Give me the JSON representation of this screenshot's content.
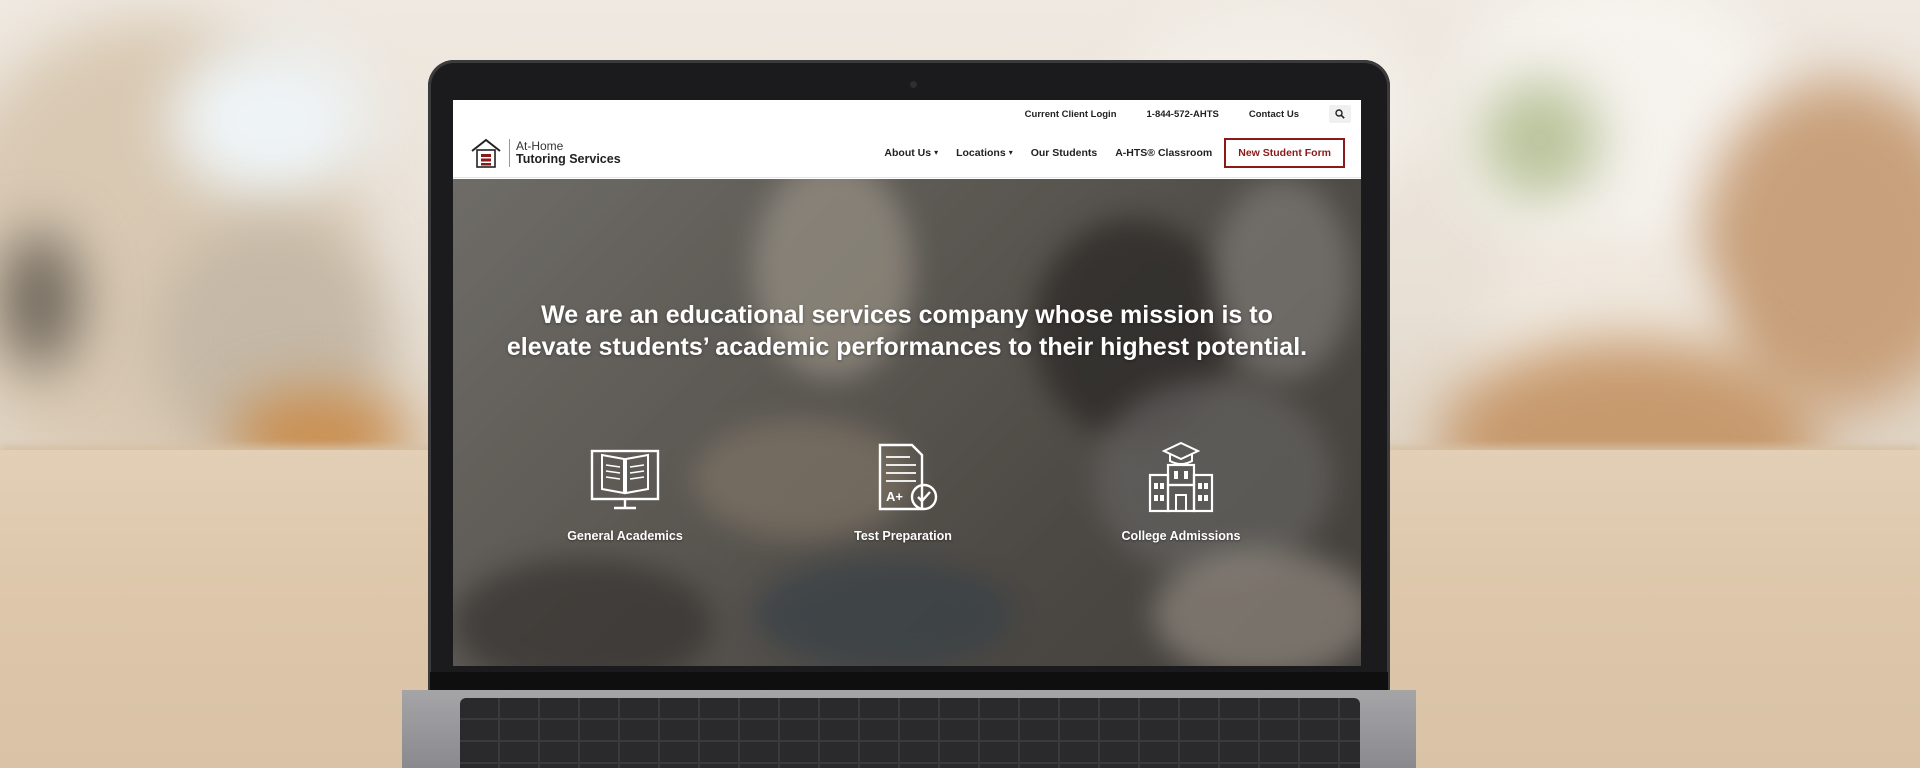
{
  "site": {
    "logo": {
      "line1": "At-Home",
      "line2": "Tutoring Services",
      "icon": "house-logo-icon"
    },
    "topbar": {
      "links": [
        {
          "label": "Current Client Login"
        },
        {
          "label": "1-844-572-AHTS"
        },
        {
          "label": "Contact Us"
        }
      ],
      "search_icon": "search-icon"
    },
    "nav": {
      "items": [
        {
          "label": "About Us",
          "dropdown": true
        },
        {
          "label": "Locations",
          "dropdown": true
        },
        {
          "label": "Our Students",
          "dropdown": false
        },
        {
          "label": "A-HTS® Classroom",
          "dropdown": false
        }
      ],
      "cta_label": "New Student Form"
    },
    "hero": {
      "headline": "We are an educational services company whose mission is to elevate students’ academic performances to their highest potential."
    },
    "services": [
      {
        "label": "General Academics",
        "icon": "book-monitor-icon"
      },
      {
        "label": "Test Preparation",
        "icon": "test-paper-icon"
      },
      {
        "label": "College Admissions",
        "icon": "college-building-icon"
      }
    ]
  },
  "colors": {
    "accent": "#8a1a1a",
    "nav_text": "#222222",
    "hero_text": "#ffffff"
  }
}
